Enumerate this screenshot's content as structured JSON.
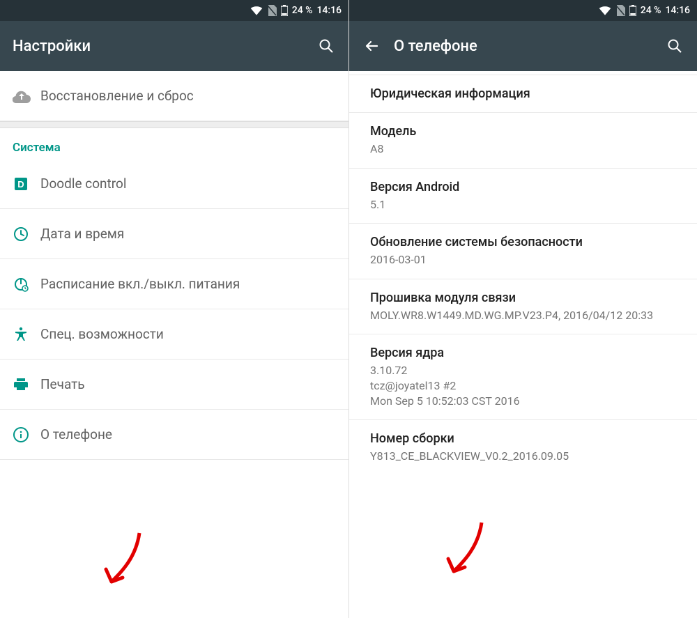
{
  "status": {
    "battery": "24 %",
    "time": "14:16"
  },
  "left": {
    "appbar_title": "Настройки",
    "backup_label": "Восстановление и сброс",
    "section_label": "Система",
    "items": {
      "doodle": "Doodle control",
      "datetime": "Дата и время",
      "schedule": "Расписание вкл./выкл. питания",
      "accessibility": "Спец. возможности",
      "print": "Печать",
      "about": "О телефоне"
    }
  },
  "right": {
    "appbar_title": "О телефоне",
    "rows": {
      "legal": {
        "title": "Юридическая информация"
      },
      "model": {
        "title": "Модель",
        "sub": "A8"
      },
      "android": {
        "title": "Версия Android",
        "sub": "5.1"
      },
      "patch": {
        "title": "Обновление системы безопасности",
        "sub": "2016-03-01"
      },
      "baseband": {
        "title": "Прошивка модуля связи",
        "sub": "MOLY.WR8.W1449.MD.WG.MP.V23.P4, 2016/04/12 20:33"
      },
      "kernel": {
        "title": "Версия ядра",
        "sub": "3.10.72\ntcz@joyatel13 #2\nMon Sep 5 10:52:03 CST 2016"
      },
      "build": {
        "title": "Номер сборки",
        "sub": "Y813_CE_BLACKVIEW_V0.2_2016.09.05"
      }
    }
  }
}
